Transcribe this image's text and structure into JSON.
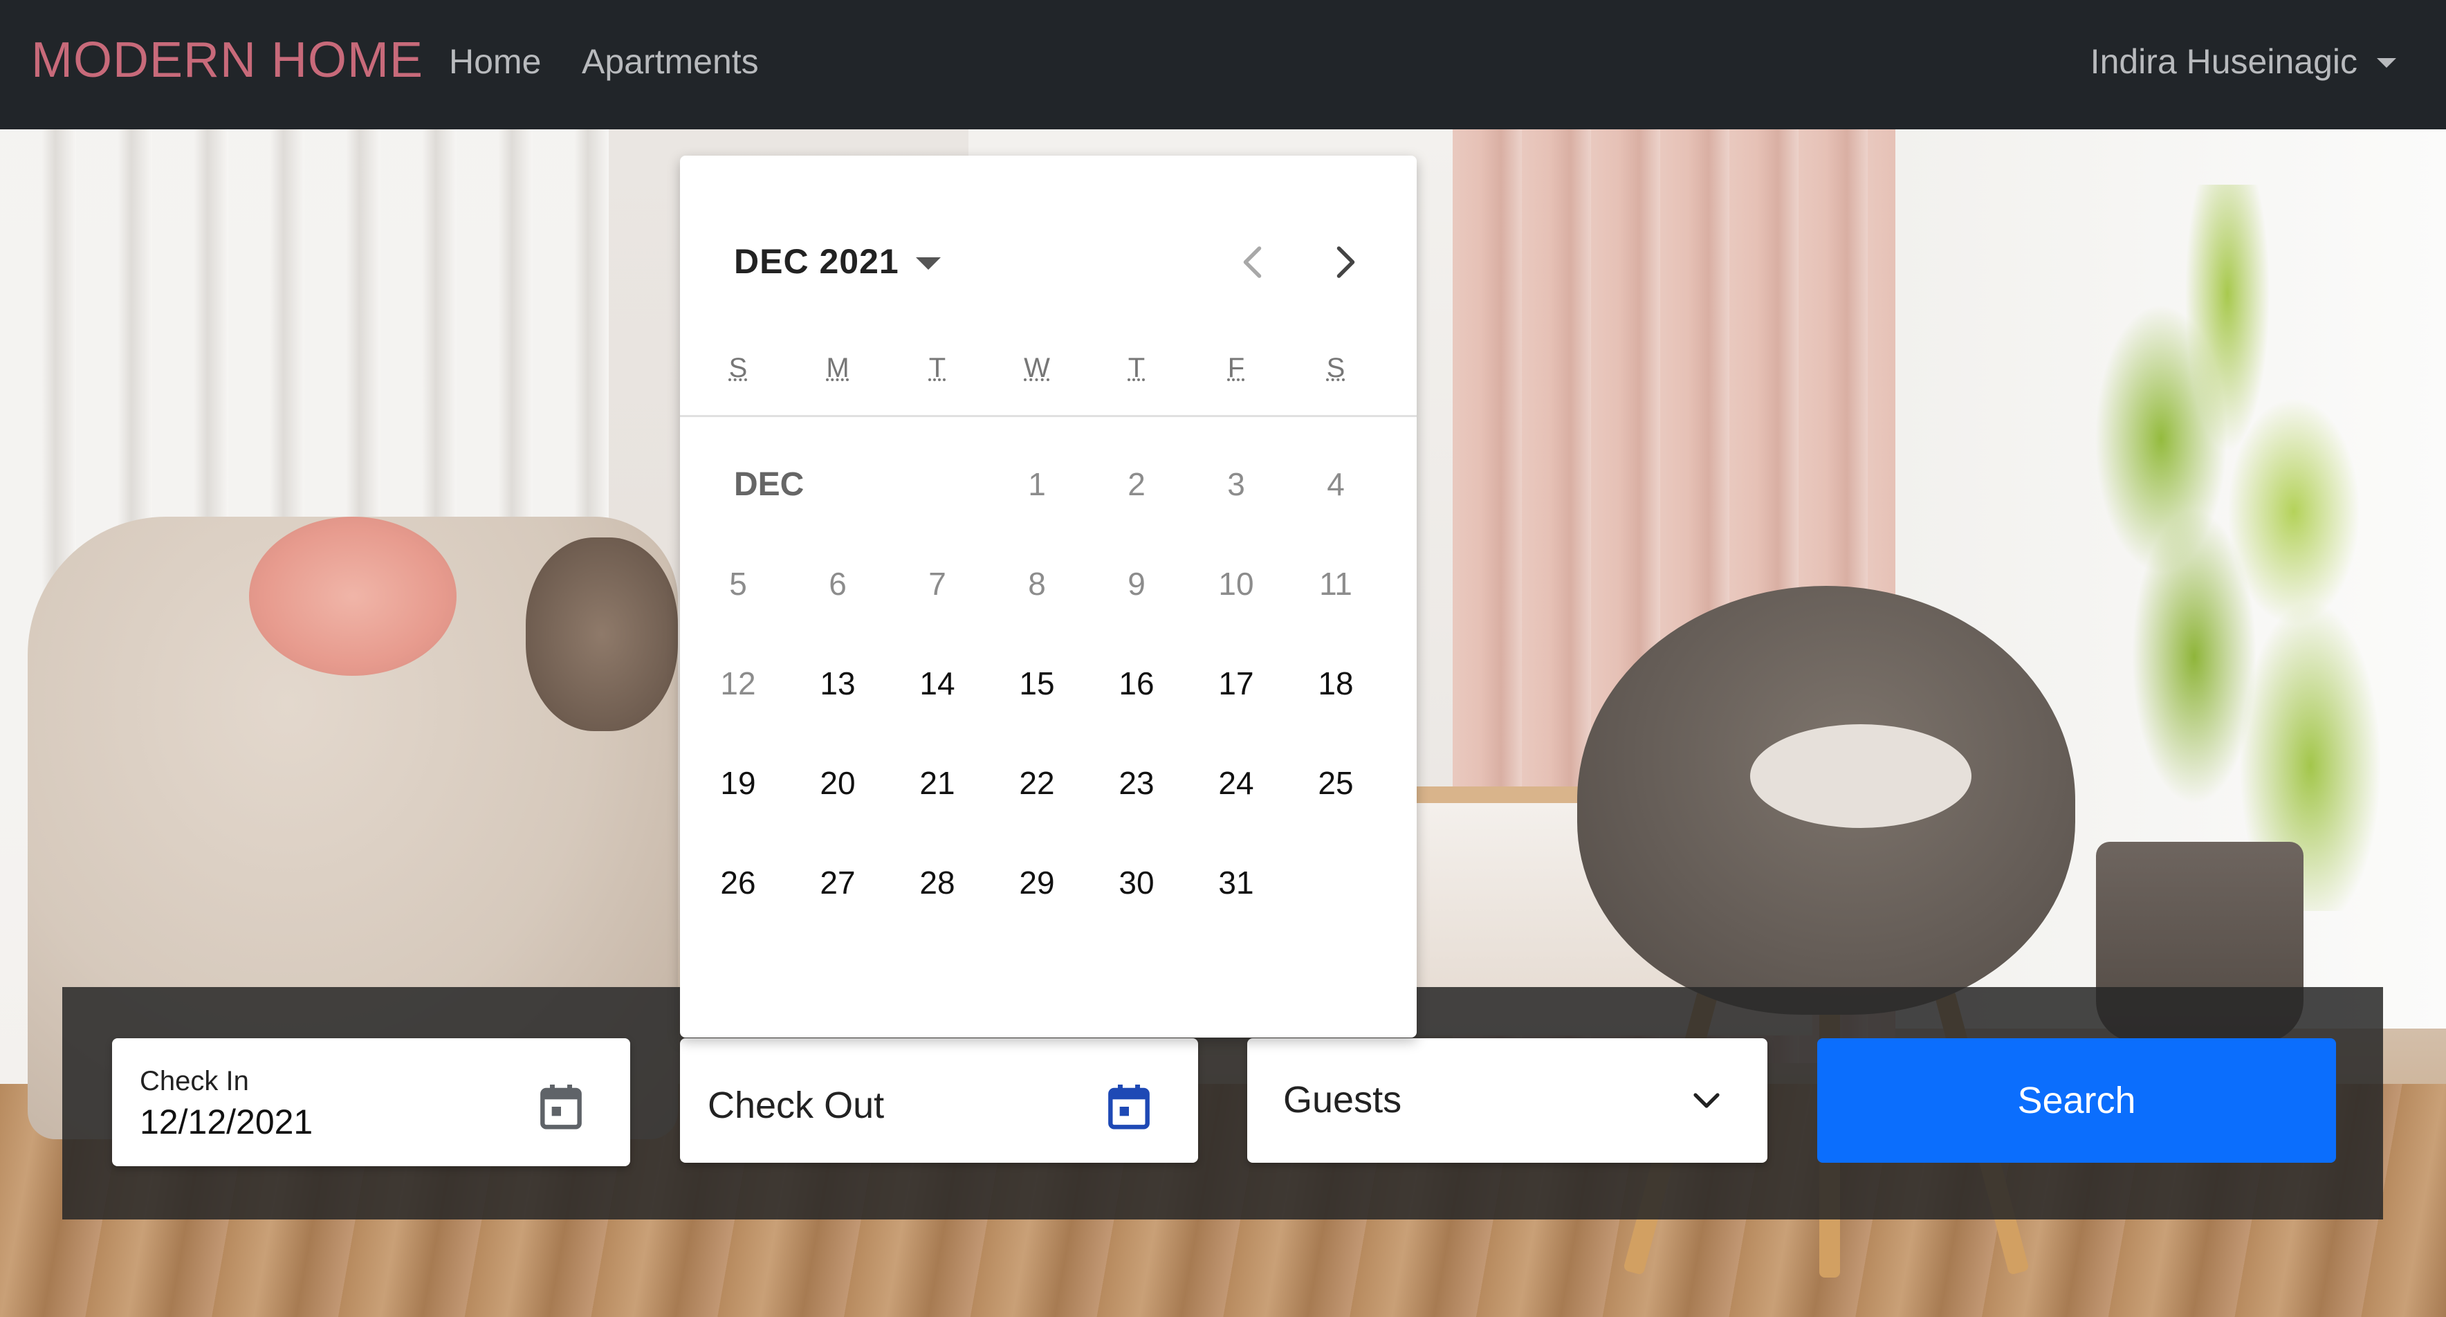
{
  "navbar": {
    "brand": "MODERN HOME",
    "links": [
      "Home",
      "Apartments"
    ],
    "user": "Indira Huseinagic"
  },
  "search": {
    "checkin_label": "Check In",
    "checkin_value": "12/12/2021",
    "checkout_label": "Check Out",
    "guests_label": "Guests",
    "search_button": "Search"
  },
  "datepicker": {
    "month_year": "DEC 2021",
    "month_short": "DEC",
    "weekdays": [
      "S",
      "M",
      "T",
      "W",
      "T",
      "F",
      "S"
    ],
    "weeks": [
      [
        "",
        "",
        "",
        "1",
        "2",
        "3",
        "4"
      ],
      [
        "5",
        "6",
        "7",
        "8",
        "9",
        "10",
        "11"
      ],
      [
        "12",
        "13",
        "14",
        "15",
        "16",
        "17",
        "18"
      ],
      [
        "19",
        "20",
        "21",
        "22",
        "23",
        "24",
        "25"
      ],
      [
        "26",
        "27",
        "28",
        "29",
        "30",
        "31",
        ""
      ]
    ],
    "first_enabled_day": 13
  },
  "colors": {
    "navbar_bg": "#212529",
    "brand": "#c86a7a",
    "nav_link": "#b8babd",
    "primary_button": "#0b6efd",
    "checkout_icon_active": "#1e49b5"
  },
  "icons": {
    "checkin": "calendar-icon",
    "checkout": "calendar-icon",
    "guests": "chevron-down-icon",
    "prev_month": "chevron-left-icon",
    "next_month": "chevron-right-icon",
    "month_dropdown": "caret-down-icon",
    "user_dropdown": "caret-down-icon"
  }
}
